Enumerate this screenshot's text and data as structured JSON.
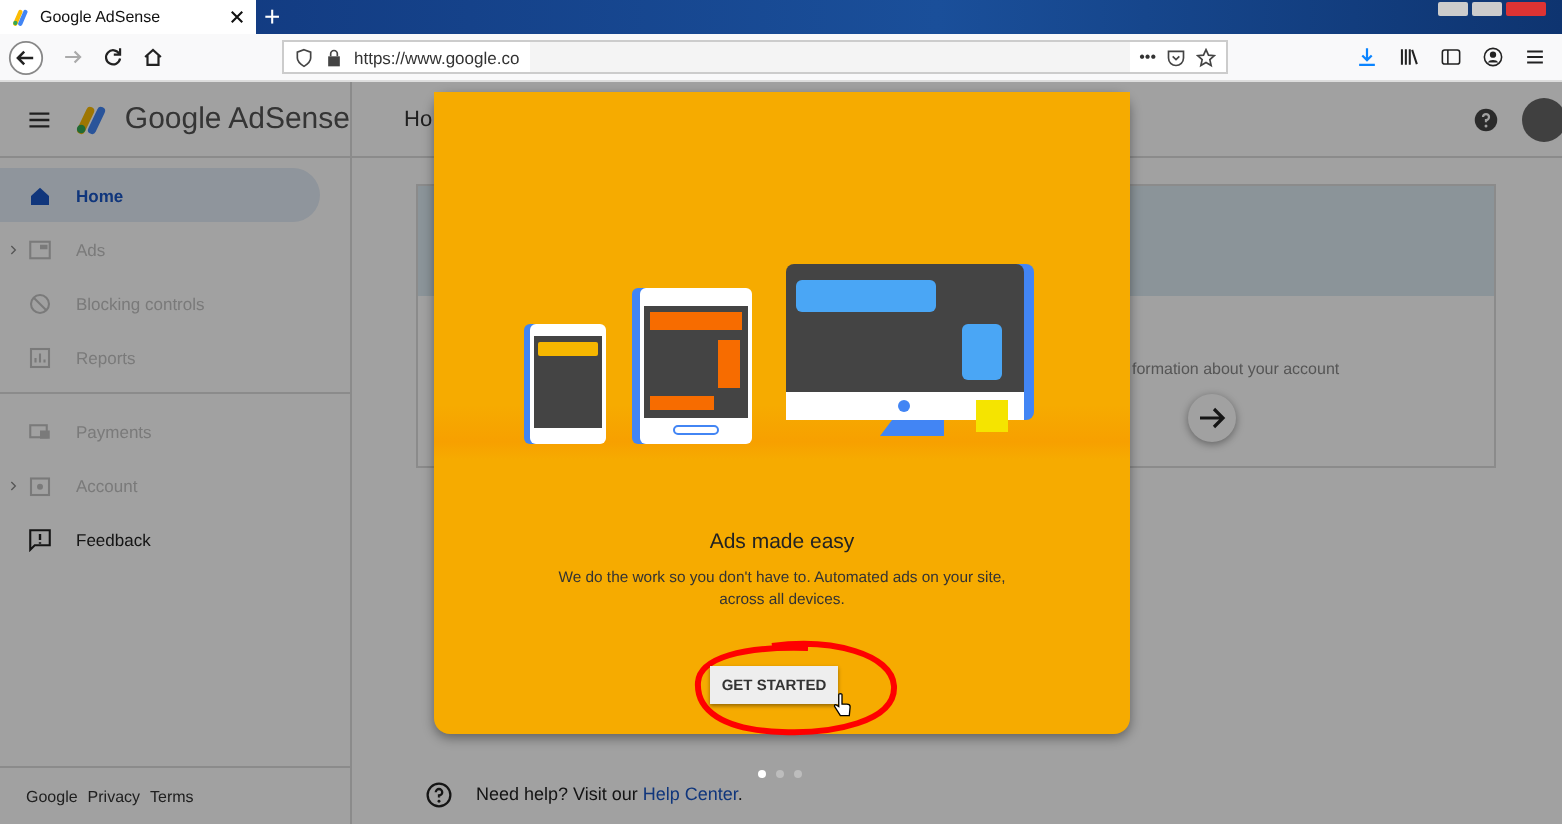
{
  "browser": {
    "tab_title": "Google AdSense",
    "new_tab": "+",
    "url": "https://www.google.co",
    "page_actions": "•••"
  },
  "header": {
    "app_name": "Google AdSense",
    "page_title": "Ho"
  },
  "sidebar": {
    "items": [
      {
        "label": "Home",
        "selected": true,
        "disabled": false,
        "expandable": false
      },
      {
        "label": "Ads",
        "selected": false,
        "disabled": true,
        "expandable": true
      },
      {
        "label": "Blocking controls",
        "selected": false,
        "disabled": true,
        "expandable": false
      },
      {
        "label": "Reports",
        "selected": false,
        "disabled": true,
        "expandable": false
      },
      {
        "label": "Payments",
        "selected": false,
        "disabled": true,
        "expandable": false
      },
      {
        "label": "Account",
        "selected": false,
        "disabled": true,
        "expandable": true
      },
      {
        "label": "Feedback",
        "selected": false,
        "disabled": false,
        "expandable": false
      }
    ],
    "footer_links": [
      "Google",
      "Privacy",
      "Terms"
    ]
  },
  "main": {
    "card_text": "formation about your account",
    "help_text": "Need help? Visit our ",
    "help_link": "Help Center",
    "help_end": "."
  },
  "dialog": {
    "title": "Ads made easy",
    "description": "We do the work so you don't have to. Automated ads on your site, across all devices.",
    "button": "GET STARTED",
    "pages": [
      {
        "selected": true
      },
      {
        "selected": false
      },
      {
        "selected": false
      }
    ]
  }
}
